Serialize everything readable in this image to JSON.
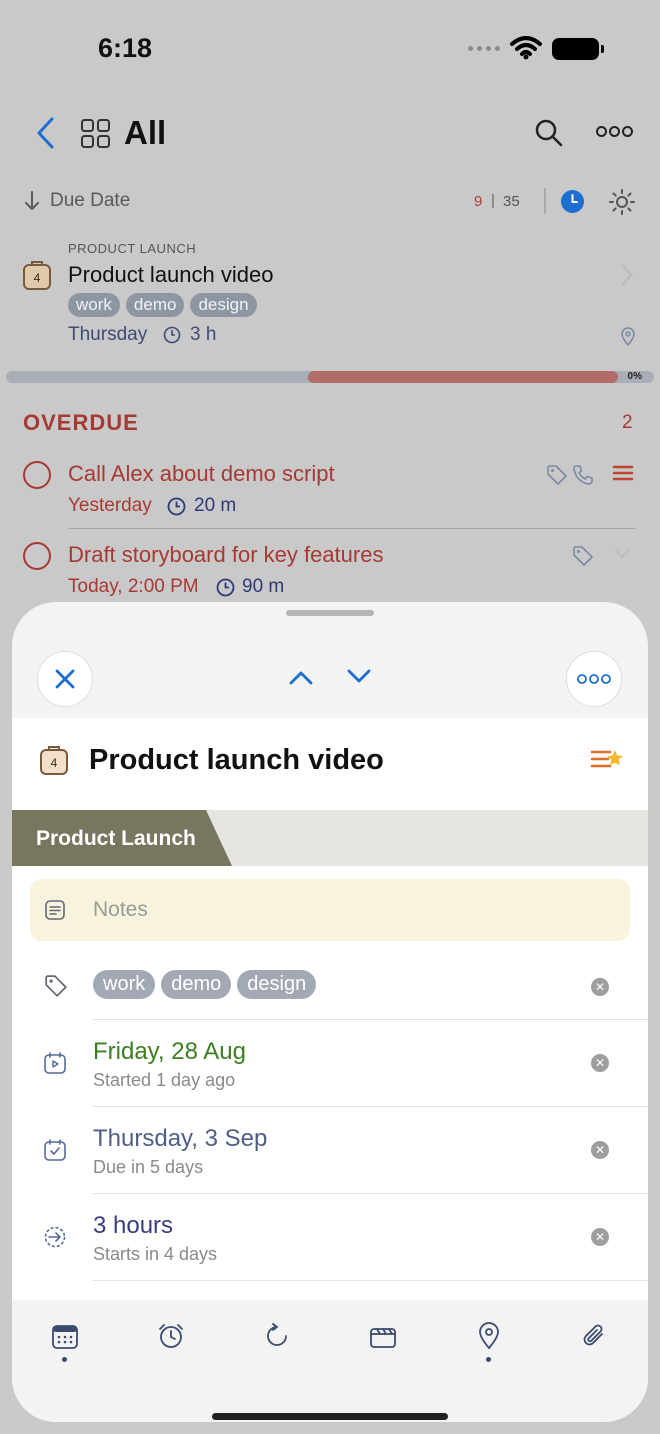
{
  "status": {
    "time": "6:18"
  },
  "nav": {
    "title": "All"
  },
  "sort": {
    "label": "Due Date",
    "count_overdue": "9",
    "separator": "|",
    "count_total": "35"
  },
  "project_row": {
    "kicker": "PRODUCT LAUNCH",
    "title": "Product launch video",
    "icon_number": "4",
    "tags": [
      "work",
      "demo",
      "design"
    ],
    "day": "Thursday",
    "duration": "3 h"
  },
  "progress": {
    "label": "0%",
    "value": 0
  },
  "overdue": {
    "title": "OVERDUE",
    "count": "2",
    "tasks": [
      {
        "title": "Call Alex about demo script",
        "when": "Yesterday",
        "duration": "20 m"
      },
      {
        "title": "Draft storyboard for key features",
        "when": "Today, 2:00 PM",
        "duration": "90 m"
      }
    ]
  },
  "sheet": {
    "title": "Product launch video",
    "icon_number": "4",
    "project": "Product Launch",
    "notes_placeholder": "Notes",
    "tags": [
      "work",
      "demo",
      "design"
    ],
    "start": {
      "main": "Friday, 28 Aug",
      "sub": "Started 1 day ago"
    },
    "due": {
      "main": "Thursday, 3 Sep",
      "sub": "Due in 5 days"
    },
    "duration": {
      "main": "3 hours",
      "sub": "Starts in 4 days"
    },
    "clear_glyph": "✕"
  },
  "colors": {
    "overdue": "#a63a33",
    "accent": "#1a6fd0",
    "project": "#797660",
    "start": "#3b7f1f"
  }
}
